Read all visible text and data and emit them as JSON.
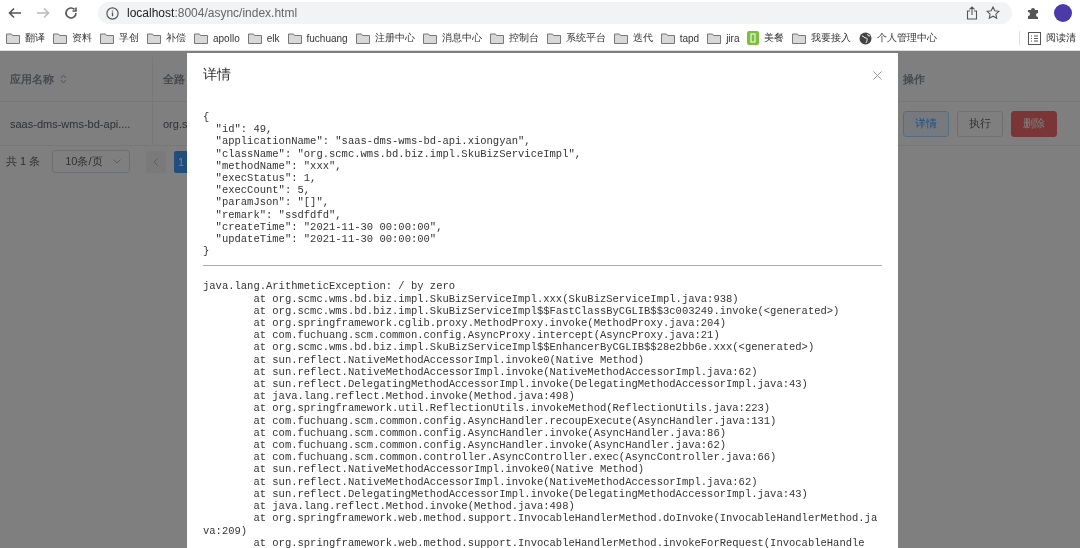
{
  "browser": {
    "url_host": "localhost",
    "url_rest": ":8004/async/index.html",
    "forward_disabled": true,
    "bookmarks": [
      {
        "label": "翻译",
        "kind": "folder"
      },
      {
        "label": "资料",
        "kind": "folder"
      },
      {
        "label": "孚创",
        "kind": "folder"
      },
      {
        "label": "补偿",
        "kind": "folder"
      },
      {
        "label": "apollo",
        "kind": "folder"
      },
      {
        "label": "elk",
        "kind": "folder"
      },
      {
        "label": "fuchuang",
        "kind": "folder"
      },
      {
        "label": "注册中心",
        "kind": "folder"
      },
      {
        "label": "消息中心",
        "kind": "folder"
      },
      {
        "label": "控制台",
        "kind": "folder"
      },
      {
        "label": "系统平台",
        "kind": "folder"
      },
      {
        "label": "迭代",
        "kind": "folder"
      },
      {
        "label": "tapd",
        "kind": "folder"
      },
      {
        "label": "jira",
        "kind": "folder"
      },
      {
        "label": "美餐",
        "kind": "app"
      },
      {
        "label": "我要接入",
        "kind": "folder"
      },
      {
        "label": "个人管理中心",
        "kind": "globe"
      }
    ],
    "reading_list": "阅读清"
  },
  "table": {
    "columns": [
      {
        "label": "应用名称",
        "sortable": true
      },
      {
        "label": "全路"
      }
    ],
    "action_column": "操作",
    "rows": [
      {
        "cells": [
          "saas-dms-wms-bd-api....",
          "org.s"
        ],
        "actions": [
          {
            "label": "详情",
            "kind": "primary"
          },
          {
            "label": "执行",
            "kind": "default"
          },
          {
            "label": "删除",
            "kind": "danger"
          }
        ]
      }
    ]
  },
  "pagination": {
    "total": "共 1 条",
    "page_size": "10条/页",
    "pages": [
      {
        "label": "1",
        "selected": true
      }
    ]
  },
  "modal": {
    "title": "详情",
    "json_lines": [
      "{",
      "  \"id\": 49,",
      "  \"applicationName\": \"saas-dms-wms-bd-api.xiongyan\",",
      "  \"className\": \"org.scmc.wms.bd.biz.impl.SkuBizServiceImpl\",",
      "  \"methodName\": \"xxx\",",
      "  \"execStatus\": 1,",
      "  \"execCount\": 5,",
      "  \"paramJson\": \"[]\",",
      "  \"remark\": \"ssdfdfd\",",
      "  \"createTime\": \"2021-11-30 00:00:00\",",
      "  \"updateTime\": \"2021-11-30 00:00:00\"",
      "}"
    ],
    "trace": [
      {
        "kind": "exception",
        "text": "java.lang.ArithmeticException: / by zero"
      },
      {
        "kind": "frame",
        "text": "at org.scmc.wms.bd.biz.impl.SkuBizServiceImpl.xxx(SkuBizServiceImpl.java:938)"
      },
      {
        "kind": "frame",
        "text": "at org.scmc.wms.bd.biz.impl.SkuBizServiceImpl$$FastClassByCGLIB$$3c003249.invoke(<generated>)"
      },
      {
        "kind": "frame",
        "text": "at org.springframework.cglib.proxy.MethodProxy.invoke(MethodProxy.java:204)"
      },
      {
        "kind": "frame",
        "text": "at com.fuchuang.scm.common.config.AsyncProxy.intercept(AsyncProxy.java:21)"
      },
      {
        "kind": "frame",
        "text": "at org.scmc.wms.bd.biz.impl.SkuBizServiceImpl$$EnhancerByCGLIB$$28e2bb6e.xxx(<generated>)"
      },
      {
        "kind": "frame",
        "text": "at sun.reflect.NativeMethodAccessorImpl.invoke0(Native Method)"
      },
      {
        "kind": "frame",
        "text": "at sun.reflect.NativeMethodAccessorImpl.invoke(NativeMethodAccessorImpl.java:62)"
      },
      {
        "kind": "frame",
        "text": "at sun.reflect.DelegatingMethodAccessorImpl.invoke(DelegatingMethodAccessorImpl.java:43)"
      },
      {
        "kind": "frame",
        "text": "at java.lang.reflect.Method.invoke(Method.java:498)"
      },
      {
        "kind": "frame",
        "text": "at org.springframework.util.ReflectionUtils.invokeMethod(ReflectionUtils.java:223)"
      },
      {
        "kind": "frame",
        "text": "at com.fuchuang.scm.common.config.AsyncHandler.recoupExecute(AsyncHandler.java:131)"
      },
      {
        "kind": "frame",
        "text": "at com.fuchuang.scm.common.config.AsyncHandler.invoke(AsyncHandler.java:86)"
      },
      {
        "kind": "frame",
        "text": "at com.fuchuang.scm.common.config.AsyncHandler.invoke(AsyncHandler.java:62)"
      },
      {
        "kind": "frame",
        "text": "at com.fuchuang.scm.common.controller.AsyncController.exec(AsyncController.java:66)"
      },
      {
        "kind": "frame",
        "text": "at sun.reflect.NativeMethodAccessorImpl.invoke0(Native Method)"
      },
      {
        "kind": "frame",
        "text": "at sun.reflect.NativeMethodAccessorImpl.invoke(NativeMethodAccessorImpl.java:62)"
      },
      {
        "kind": "frame",
        "text": "at sun.reflect.DelegatingMethodAccessorImpl.invoke(DelegatingMethodAccessorImpl.java:43)"
      },
      {
        "kind": "frame",
        "text": "at java.lang.reflect.Method.invoke(Method.java:498)"
      },
      {
        "kind": "frame",
        "text": "at org.springframework.web.method.support.InvocableHandlerMethod.doInvoke(InvocableHandlerMethod.java:209)"
      },
      {
        "kind": "frame",
        "text": "at org.springframework.web.method.support.InvocableHandlerMethod.invokeForRequest(InvocableHandle"
      }
    ]
  }
}
